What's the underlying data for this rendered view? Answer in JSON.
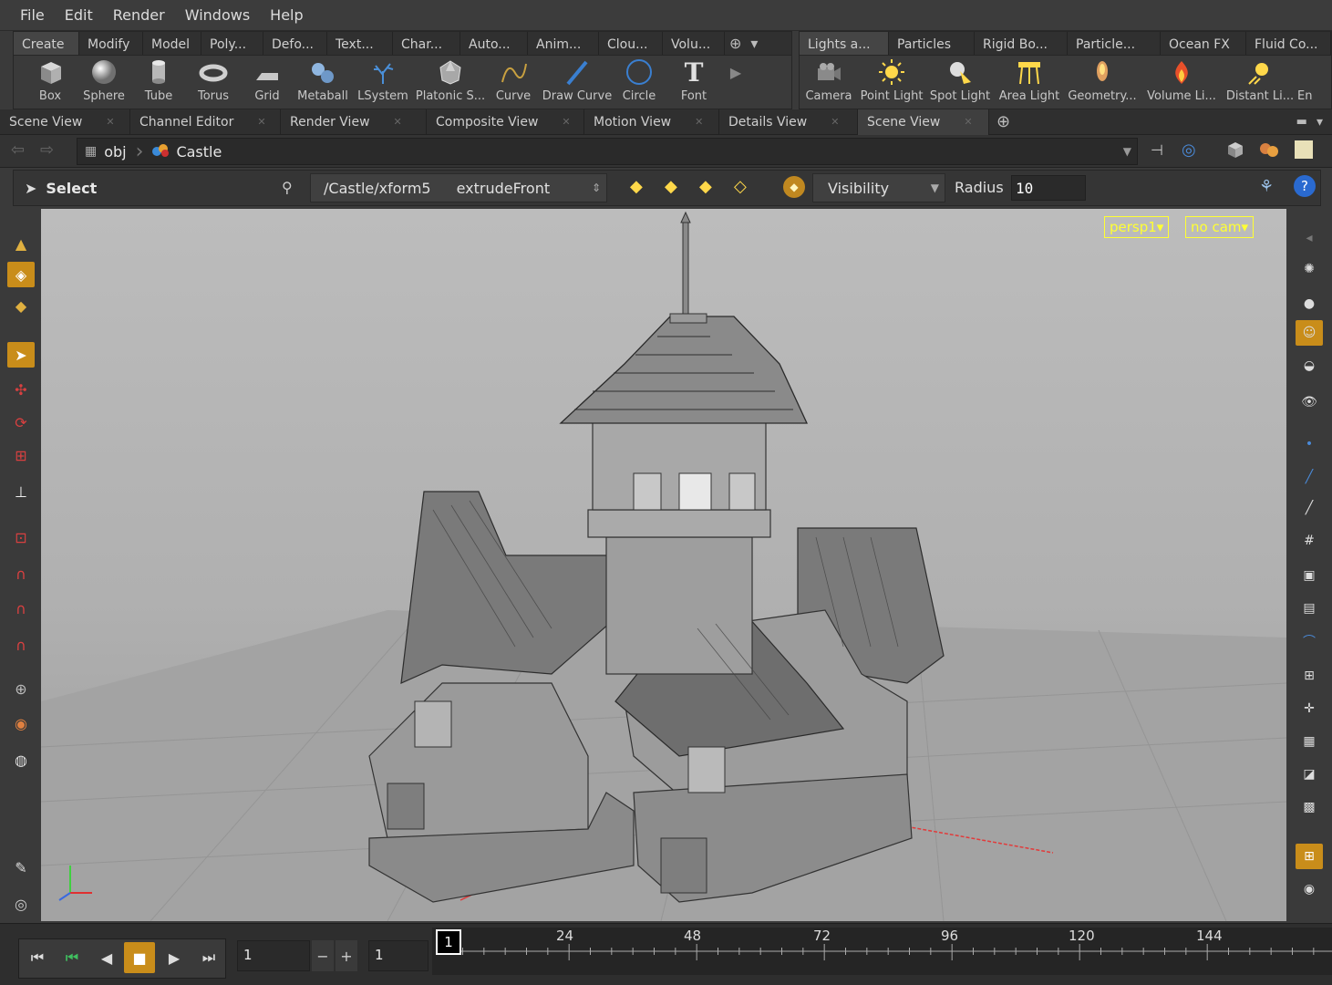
{
  "menu": [
    "File",
    "Edit",
    "Render",
    "Windows",
    "Help"
  ],
  "shelf_left": {
    "tabs": [
      "Create",
      "Modify",
      "Model",
      "Poly...",
      "Defo...",
      "Text...",
      "Char...",
      "Auto...",
      "Anim...",
      "Clou...",
      "Volu..."
    ],
    "tools": [
      {
        "label": "Box",
        "icon": "box-icon"
      },
      {
        "label": "Sphere",
        "icon": "sphere-icon"
      },
      {
        "label": "Tube",
        "icon": "tube-icon"
      },
      {
        "label": "Torus",
        "icon": "torus-icon"
      },
      {
        "label": "Grid",
        "icon": "grid-icon"
      },
      {
        "label": "Metaball",
        "icon": "metaball-icon"
      },
      {
        "label": "LSystem",
        "icon": "lsystem-icon"
      },
      {
        "label": "Platonic S...",
        "icon": "platonic-icon"
      },
      {
        "label": "Curve",
        "icon": "curve-icon"
      },
      {
        "label": "Draw Curve",
        "icon": "draw-curve-icon"
      },
      {
        "label": "Circle",
        "icon": "circle-icon"
      },
      {
        "label": "Font",
        "icon": "font-icon"
      }
    ]
  },
  "shelf_right": {
    "tabs": [
      "Lights a...",
      "Particles",
      "Rigid Bo...",
      "Particle...",
      "Ocean FX",
      "Fluid Co..."
    ],
    "tools": [
      {
        "label": "Camera",
        "icon": "camera-icon"
      },
      {
        "label": "Point Light",
        "icon": "point-light-icon"
      },
      {
        "label": "Spot Light",
        "icon": "spot-light-icon"
      },
      {
        "label": "Area Light",
        "icon": "area-light-icon"
      },
      {
        "label": "Geometry...",
        "icon": "geometry-light-icon"
      },
      {
        "label": "Volume Li...",
        "icon": "volume-light-icon"
      },
      {
        "label": "Distant Li...",
        "icon": "distant-light-icon"
      },
      {
        "label": "En",
        "icon": "environment-light-icon"
      }
    ]
  },
  "panel_tabs": [
    "Scene View",
    "Channel Editor",
    "Render View",
    "Composite View",
    "Motion View",
    "Details View",
    "Scene View"
  ],
  "path": {
    "root": "obj",
    "node": "Castle"
  },
  "options": {
    "tool": "Select",
    "node_path": "/Castle/xform5",
    "node_name": "extrudeFront",
    "visibility": "Visibility",
    "radius_label": "Radius",
    "radius_value": "10"
  },
  "viewport": {
    "camera": "persp1",
    "cam_menu": "no cam"
  },
  "timeline": {
    "current_frame": "1",
    "step": "1",
    "marker": "1",
    "ticks": [
      "24",
      "48",
      "72",
      "96",
      "120",
      "144"
    ]
  },
  "colors": {
    "accent": "#c98d1a",
    "badge": "#ffff33",
    "axis_red": "#e23a3a"
  }
}
